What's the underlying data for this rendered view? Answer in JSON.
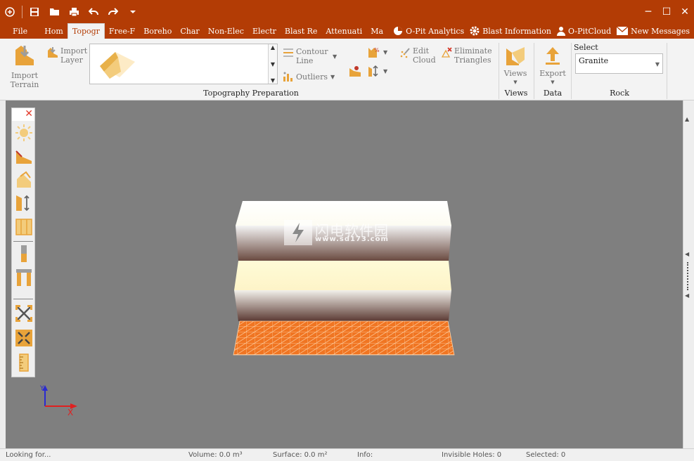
{
  "quick_access": {
    "icons": [
      "app-icon",
      "save-icon",
      "open-folder-icon",
      "print-icon",
      "undo-icon",
      "redo-icon",
      "customize-dropdown-icon"
    ]
  },
  "window_controls": {
    "minimize": "─",
    "maximize": "☐",
    "close": "✕"
  },
  "menu": {
    "file": "File",
    "tabs": [
      "Hom",
      "Topogr",
      "Free-F",
      "Boreho",
      "Char",
      "Non-Elec",
      "Electr",
      "Blast Re",
      "Attenuati",
      "Ma"
    ],
    "active_tab": "Topogr",
    "right_items": [
      "O-Pit Analytics",
      "Blast Information",
      "O-PitCloud",
      "New Messages"
    ]
  },
  "ribbon": {
    "import_terrain": "Import Terrain",
    "import_layer": "Import Layer",
    "contour_line": "Contour Line",
    "outliers": "Outliers",
    "edit_cloud": "Edit Cloud",
    "eliminate_triangles": "Eliminate Triangles",
    "topography_preparation": "Topography Preparation",
    "views_button": "Views",
    "views_group": "Views",
    "export_button": "Export",
    "data_group": "Data",
    "select_label": "Select",
    "select_value": "Granite",
    "rock_group": "Rock"
  },
  "left_toolbar": {
    "icons": [
      "sun-light-icon",
      "terrain-icon",
      "paint-bucket-icon",
      "layer-height-icon",
      "grid-panel-icon",
      "single-column-icon",
      "double-column-icon",
      "explode-icon",
      "collapse-icon",
      "ruler-icon"
    ]
  },
  "axes": {
    "y": "Y",
    "x": "X"
  },
  "watermark": {
    "title": "闪电软件园",
    "url": "www.sd173.com"
  },
  "status": {
    "looking_for": "Looking for...",
    "volume": "Volume: 0.0 m³",
    "surface": "Surface: 0.0 m²",
    "info": "Info:",
    "invisible_holes": "Invisible Holes: 0",
    "selected": "Selected: 0"
  },
  "colors": {
    "title_bar": "#b33c05",
    "accent_orange": "#e8a33a",
    "ground_grid": "#f07522",
    "layer_top": "#fffdf0",
    "layer_mid": "#fffbd7"
  }
}
